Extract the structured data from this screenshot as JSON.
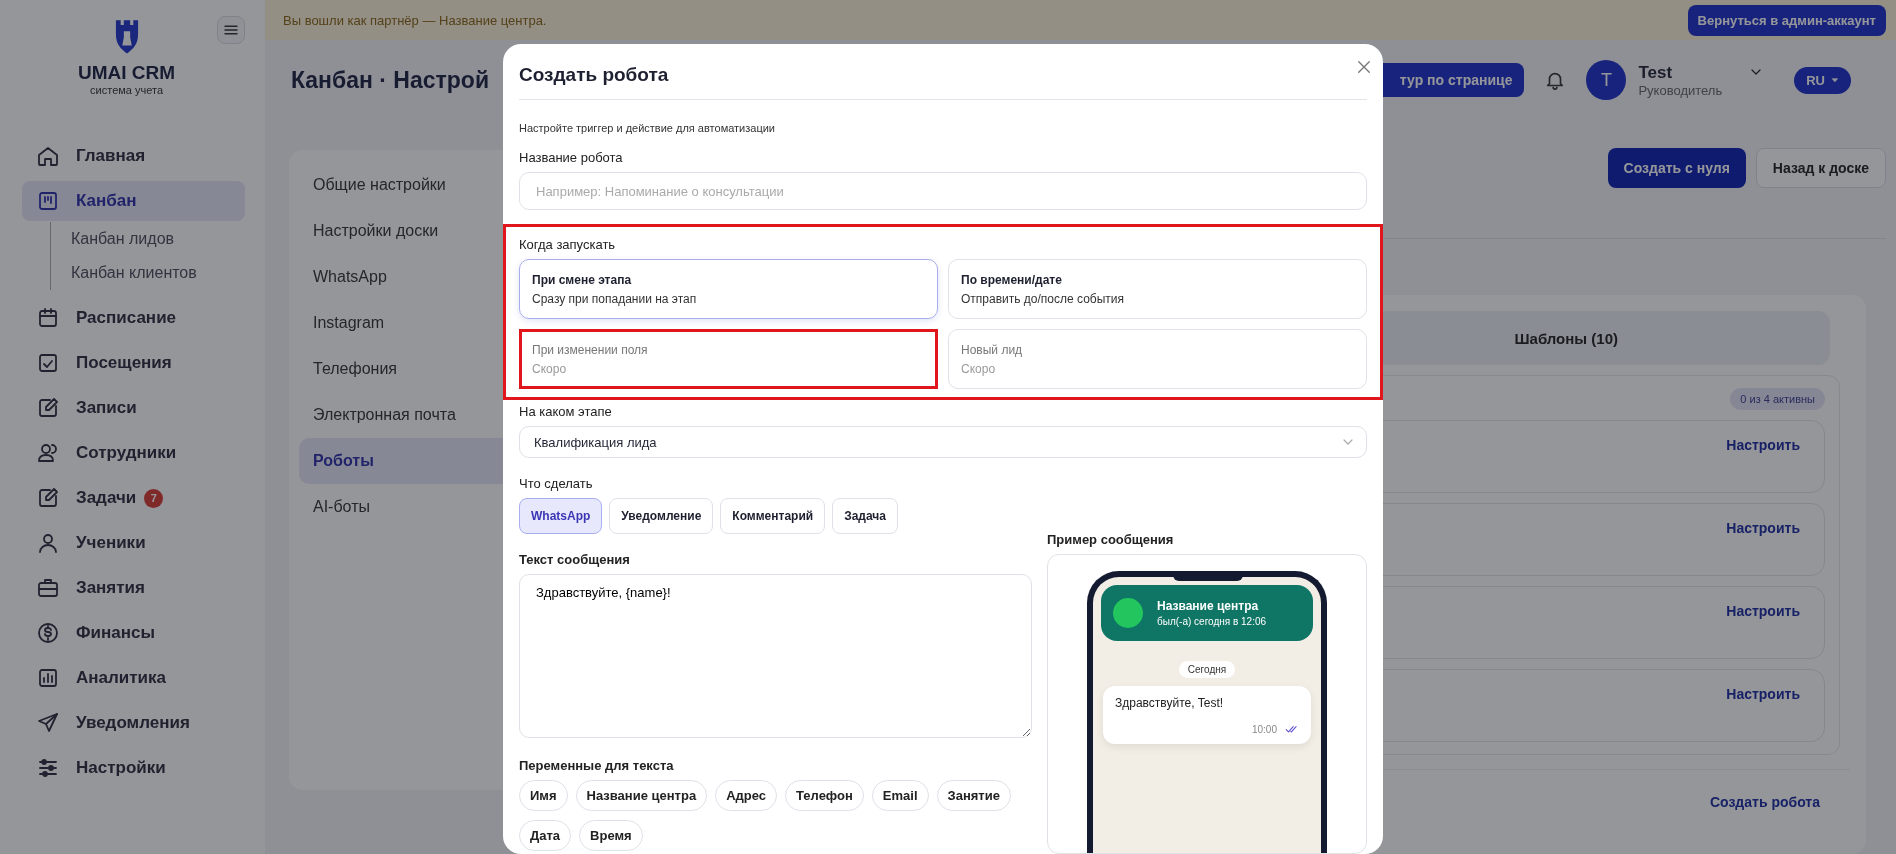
{
  "banner": {
    "text": "Вы вошли как партнёр — Название центра.",
    "button": "Вернуться в админ-аккаунт"
  },
  "sidebar": {
    "logo_title": "UMAI CRM",
    "logo_subtitle": "система учета",
    "items": [
      {
        "label": "Главная",
        "selected": false
      },
      {
        "label": "Канбан",
        "selected": true,
        "children": [
          {
            "label": "Канбан лидов",
            "selected": false
          },
          {
            "label": "Канбан клиентов",
            "selected": false
          }
        ]
      },
      {
        "label": "Расписание",
        "selected": false
      },
      {
        "label": "Посещения",
        "selected": false
      },
      {
        "label": "Записи",
        "selected": false
      },
      {
        "label": "Сотрудники",
        "selected": false
      },
      {
        "label": "Задачи",
        "selected": false,
        "badge": "7"
      },
      {
        "label": "Ученики",
        "selected": false
      },
      {
        "label": "Занятия",
        "selected": false
      },
      {
        "label": "Финансы",
        "selected": false
      },
      {
        "label": "Аналитика",
        "selected": false
      },
      {
        "label": "Уведомления",
        "selected": false
      },
      {
        "label": "Настройки",
        "selected": false
      }
    ]
  },
  "header": {
    "title": "Канбан · Настрой",
    "tour_button": "тур по странице",
    "user": {
      "initial": "T",
      "name": "Test",
      "role": "Руководитель"
    },
    "language": "RU"
  },
  "actions": {
    "create": "Создать с нуля",
    "back": "Назад к доске"
  },
  "settings_menu": [
    {
      "label": "Общие настройки",
      "selected": false
    },
    {
      "label": "Настройки доски",
      "selected": false
    },
    {
      "label": "WhatsApp",
      "selected": false
    },
    {
      "label": "Instagram",
      "selected": false
    },
    {
      "label": "Телефония",
      "selected": false
    },
    {
      "label": "Электронная почта",
      "selected": false
    },
    {
      "label": "Роботы",
      "selected": true
    },
    {
      "label": "AI-боты",
      "selected": false
    }
  ],
  "tabs": [
    {
      "label": "Шаблоны (10)",
      "selected": false
    }
  ],
  "robots": {
    "badge": "0 из 4 активны",
    "items": [
      {
        "action": "Настроить"
      },
      {
        "action": "Настроить"
      },
      {
        "action": "Настроить"
      },
      {
        "action": "Настроить"
      }
    ],
    "create_link": "Создать робота"
  },
  "modal": {
    "title": "Создать робота",
    "subtitle": "Настройте триггер и действие для автоматизации",
    "name_field": {
      "label": "Название робота",
      "placeholder": "Например: Напоминание о консультации"
    },
    "trigger": {
      "label": "Когда запускать",
      "highlighted": true,
      "options": [
        {
          "title": "При смене этапа",
          "subtitle": "Сразу при попадании на этап",
          "selected": true,
          "disabled": false,
          "highlighted": false
        },
        {
          "title": "По времени/дате",
          "subtitle": "Отправить до/после события",
          "selected": false,
          "disabled": false,
          "highlighted": false
        },
        {
          "title": "При изменении поля",
          "subtitle": "Скоро",
          "selected": false,
          "disabled": true,
          "highlighted": true
        },
        {
          "title": "Новый лид",
          "subtitle": "Скоро",
          "selected": false,
          "disabled": true,
          "highlighted": false
        }
      ]
    },
    "stage": {
      "label": "На каком этапе",
      "value": "Квалификация лида"
    },
    "action": {
      "label": "Что сделать",
      "options": [
        {
          "label": "WhatsApp",
          "selected": true
        },
        {
          "label": "Уведомление",
          "selected": false
        },
        {
          "label": "Комментарий",
          "selected": false
        },
        {
          "label": "Задача",
          "selected": false
        }
      ]
    },
    "message": {
      "label": "Текст сообщения",
      "value": "Здравствуйте, {name}!"
    },
    "variables": {
      "label": "Переменные для текста",
      "chips": [
        "Имя",
        "Название центра",
        "Адрес",
        "Телефон",
        "Email",
        "Занятие",
        "Дата",
        "Время"
      ]
    },
    "preview": {
      "label": "Пример сообщения",
      "contact_name": "Название центра",
      "last_seen": "был(-а) сегодня в 12:06",
      "date": "Сегодня",
      "message": "Здравствуйте, Test!",
      "time": "10:00"
    }
  }
}
